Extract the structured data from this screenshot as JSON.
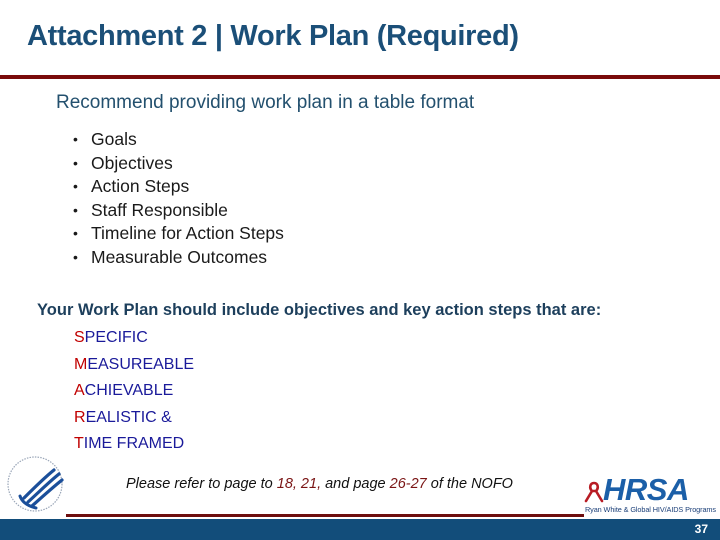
{
  "slide": {
    "title": "Attachment 2 | Work Plan (Required)",
    "subtitle": "Recommend providing work plan in a table format",
    "bullets": [
      "Goals",
      "Objectives",
      "Action Steps",
      "Staff Responsible",
      "Timeline for Action Steps",
      "Measurable Outcomes"
    ],
    "bullet_symbol": "•",
    "plan_heading": "Your Work Plan should include objectives and key action steps that are:",
    "smart": [
      {
        "initial": "S",
        "rest": "PECIFIC"
      },
      {
        "initial": "M",
        "rest": "EASUREABLE"
      },
      {
        "initial": "A",
        "rest": "CHIEVABLE"
      },
      {
        "initial": "R",
        "rest": "EALISTIC &"
      },
      {
        "initial": "T",
        "rest": "IME FRAMED"
      }
    ],
    "note": {
      "part1": "Please refer to page  to ",
      "ref1": "18, 21,",
      "part2": " and page ",
      "ref2": "26-27",
      "part3": " of the NOFO"
    }
  },
  "footer": {
    "left_logo": "hhs-eagle-seal-logo",
    "right_logo": {
      "wordmark": "HRSA",
      "tagline": "Ryan White & Global HIV/AIDS Programs",
      "icon": "red-ribbon-icon"
    },
    "page_number": "37"
  },
  "colors": {
    "title": "#1b4f78",
    "rule_dark_red": "#7a0a0a",
    "smart_initial": "#c00000",
    "smart_rest": "#1a1a9a",
    "footer_bar": "#124d7a",
    "hrsa_blue": "#1b5fa8"
  }
}
